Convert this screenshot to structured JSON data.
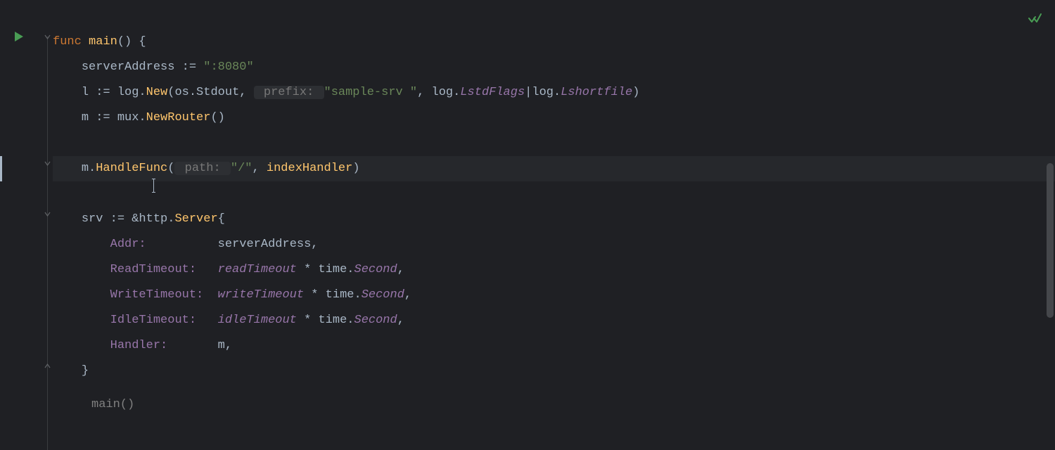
{
  "breadcrumb": "main()",
  "icons": {
    "run": "run-icon",
    "check": "check-icon",
    "fold_open": "fold-open-icon",
    "fold_close": "fold-close-icon"
  },
  "code": {
    "l1": {
      "kw": "func",
      "fn": " main",
      "rest": "() {"
    },
    "l2": {
      "indent": "    ",
      "var": "serverAddress ",
      "op": ":=",
      "str": " \":8080\""
    },
    "l3": {
      "indent": "    ",
      "t1": "l ",
      "op": ":=",
      "t2": " log.",
      "fn": "New",
      "p1": "(os.Stdout, ",
      "hint": " prefix: ",
      "str": "\"sample-srv \"",
      "t3": ", log.",
      "f1": "LstdFlags",
      "pipe": "|",
      "t4": "log.",
      "f2": "Lshortfile",
      "close": ")"
    },
    "l4": {
      "indent": "    ",
      "t1": "m ",
      "op": ":=",
      "t2": " mux.",
      "fn": "NewRouter",
      "rest": "()"
    },
    "l5": "",
    "l6": {
      "indent": "    ",
      "t1": "m.",
      "fn": "HandleFunc",
      "p1": "(",
      "hint": " path: ",
      "str": "\"/\"",
      "t2": ", ",
      "arg": "indexHandler",
      "close": ")"
    },
    "l7": "",
    "l8": {
      "indent": "    ",
      "t1": "srv ",
      "op": ":=",
      "t2": " &http.",
      "type": "Server",
      "open": "{"
    },
    "l9": {
      "indent": "        ",
      "field": "Addr:",
      "pad": "          ",
      "val": "serverAddress",
      "comma": ","
    },
    "l10": {
      "indent": "        ",
      "field": "ReadTimeout:",
      "pad": "   ",
      "ital": "readTimeout",
      "t1": " * time.",
      "ital2": "Second",
      "comma": ","
    },
    "l11": {
      "indent": "        ",
      "field": "WriteTimeout:",
      "pad": "  ",
      "ital": "writeTimeout",
      "t1": " * time.",
      "ital2": "Second",
      "comma": ","
    },
    "l12": {
      "indent": "        ",
      "field": "IdleTimeout:",
      "pad": "   ",
      "ital": "idleTimeout",
      "t1": " * time.",
      "ital2": "Second",
      "comma": ","
    },
    "l13": {
      "indent": "        ",
      "field": "Handler:",
      "pad": "       ",
      "val": "m",
      "comma": ","
    },
    "l14": {
      "indent": "    ",
      "close": "}"
    }
  }
}
